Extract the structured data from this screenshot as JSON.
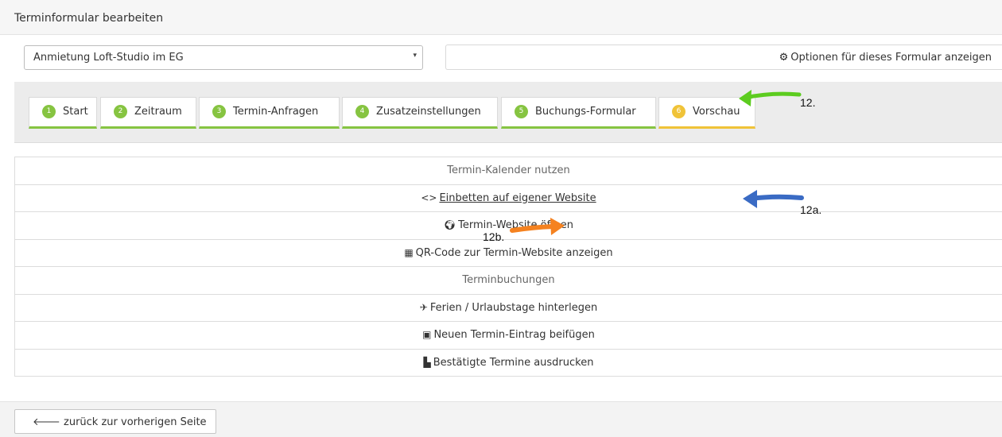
{
  "header": {
    "title": "Terminformular bearbeiten"
  },
  "form_select": {
    "value": "Anmietung Loft-Studio im EG",
    "arrow": "▾"
  },
  "options_button": {
    "icon": "gear-icon",
    "label": "Optionen für dieses Formular anzeigen"
  },
  "tabs": [
    {
      "number": "1",
      "label": "Start"
    },
    {
      "number": "2",
      "label": "Zeitraum"
    },
    {
      "number": "3",
      "label": "Termin-Anfragen"
    },
    {
      "number": "4",
      "label": "Zusatzeinstellungen"
    },
    {
      "number": "5",
      "label": "Buchungs-Formular"
    },
    {
      "number": "6",
      "label": "Vorschau"
    }
  ],
  "annotations": {
    "a12": "12.",
    "a12a": "12a.",
    "a12b": "12b."
  },
  "annotation_colors": {
    "green": "#5ccc1f",
    "blue": "#3a6bc4",
    "orange": "#f58220"
  },
  "accent": {
    "tab_done": "#86c441",
    "tab_active": "#f0c338"
  },
  "list": {
    "calendar_heading": "Termin-Kalender nutzen",
    "embed_prefix": "<>",
    "embed_label": "Einbetten auf eigener Website",
    "open_website_label": "Termin-Website öffnen",
    "qr_label": "QR-Code zur Termin-Website anzeigen",
    "bookings_heading": "Terminbuchungen",
    "holidays_label": "Ferien / Urlaubstage hinterlegen",
    "new_entry_label": "Neuen Termin-Eintrag beifügen",
    "print_label": "Bestätigte Termine ausdrucken"
  },
  "footer": {
    "back_label": "zurück zur vorherigen Seite"
  }
}
